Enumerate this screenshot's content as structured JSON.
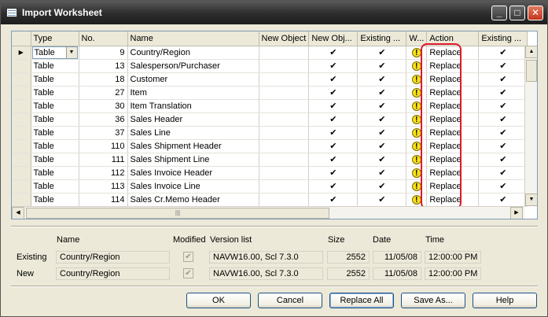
{
  "window": {
    "title": "Import Worksheet",
    "controls": {
      "minimize": "_",
      "maximize": "□",
      "close": "✕"
    }
  },
  "grid": {
    "columns": [
      "Type",
      "No.",
      "Name",
      "New Object",
      "New Obj...",
      "Existing ...",
      "W...",
      "Action",
      "Existing ..."
    ],
    "rows": [
      {
        "type": "Table",
        "no": "9",
        "name": "Country/Region",
        "new_obj": "✔",
        "existing": "✔",
        "warning": "!",
        "action": "Replace",
        "existing2": "✔"
      },
      {
        "type": "Table",
        "no": "13",
        "name": "Salesperson/Purchaser",
        "new_obj": "✔",
        "existing": "✔",
        "warning": "!",
        "action": "Replace",
        "existing2": "✔"
      },
      {
        "type": "Table",
        "no": "18",
        "name": "Customer",
        "new_obj": "✔",
        "existing": "✔",
        "warning": "!",
        "action": "Replace",
        "existing2": "✔"
      },
      {
        "type": "Table",
        "no": "27",
        "name": "Item",
        "new_obj": "✔",
        "existing": "✔",
        "warning": "!",
        "action": "Replace",
        "existing2": "✔"
      },
      {
        "type": "Table",
        "no": "30",
        "name": "Item Translation",
        "new_obj": "✔",
        "existing": "✔",
        "warning": "!",
        "action": "Replace",
        "existing2": "✔"
      },
      {
        "type": "Table",
        "no": "36",
        "name": "Sales Header",
        "new_obj": "✔",
        "existing": "✔",
        "warning": "!",
        "action": "Replace",
        "existing2": "✔"
      },
      {
        "type": "Table",
        "no": "37",
        "name": "Sales Line",
        "new_obj": "✔",
        "existing": "✔",
        "warning": "!",
        "action": "Replace",
        "existing2": "✔"
      },
      {
        "type": "Table",
        "no": "110",
        "name": "Sales Shipment Header",
        "new_obj": "✔",
        "existing": "✔",
        "warning": "!",
        "action": "Replace",
        "existing2": "✔"
      },
      {
        "type": "Table",
        "no": "111",
        "name": "Sales Shipment Line",
        "new_obj": "✔",
        "existing": "✔",
        "warning": "!",
        "action": "Replace",
        "existing2": "✔"
      },
      {
        "type": "Table",
        "no": "112",
        "name": "Sales Invoice Header",
        "new_obj": "✔",
        "existing": "✔",
        "warning": "!",
        "action": "Replace",
        "existing2": "✔"
      },
      {
        "type": "Table",
        "no": "113",
        "name": "Sales Invoice Line",
        "new_obj": "✔",
        "existing": "✔",
        "warning": "!",
        "action": "Replace",
        "existing2": "✔"
      },
      {
        "type": "Table",
        "no": "114",
        "name": "Sales Cr.Memo Header",
        "new_obj": "✔",
        "existing": "✔",
        "warning": "!",
        "action": "Replace",
        "existing2": "✔"
      }
    ],
    "scroll_glyphs": {
      "up": "▲",
      "down": "▼",
      "left": "◀",
      "right": "▶",
      "grip": "|||"
    }
  },
  "details": {
    "headers": {
      "name": "Name",
      "modified": "Modified",
      "version": "Version list",
      "size": "Size",
      "date": "Date",
      "time": "Time"
    },
    "existing": {
      "label": "Existing",
      "name": "Country/Region",
      "modified": "✔",
      "version": "NAVW16.00, Scl 7.3.0",
      "size": "2552",
      "date": "11/05/08",
      "time": "12:00:00 PM"
    },
    "new": {
      "label": "New",
      "name": "Country/Region",
      "modified": "✔",
      "version": "NAVW16.00, Scl 7.3.0",
      "size": "2552",
      "date": "11/05/08",
      "time": "12:00:00 PM"
    }
  },
  "buttons": {
    "ok": "OK",
    "cancel": "Cancel",
    "replace_all": "Replace All",
    "save_as": "Save As...",
    "help": "Help"
  },
  "colors": {
    "highlight": "#e0182a",
    "warning": "#f7e21b"
  }
}
